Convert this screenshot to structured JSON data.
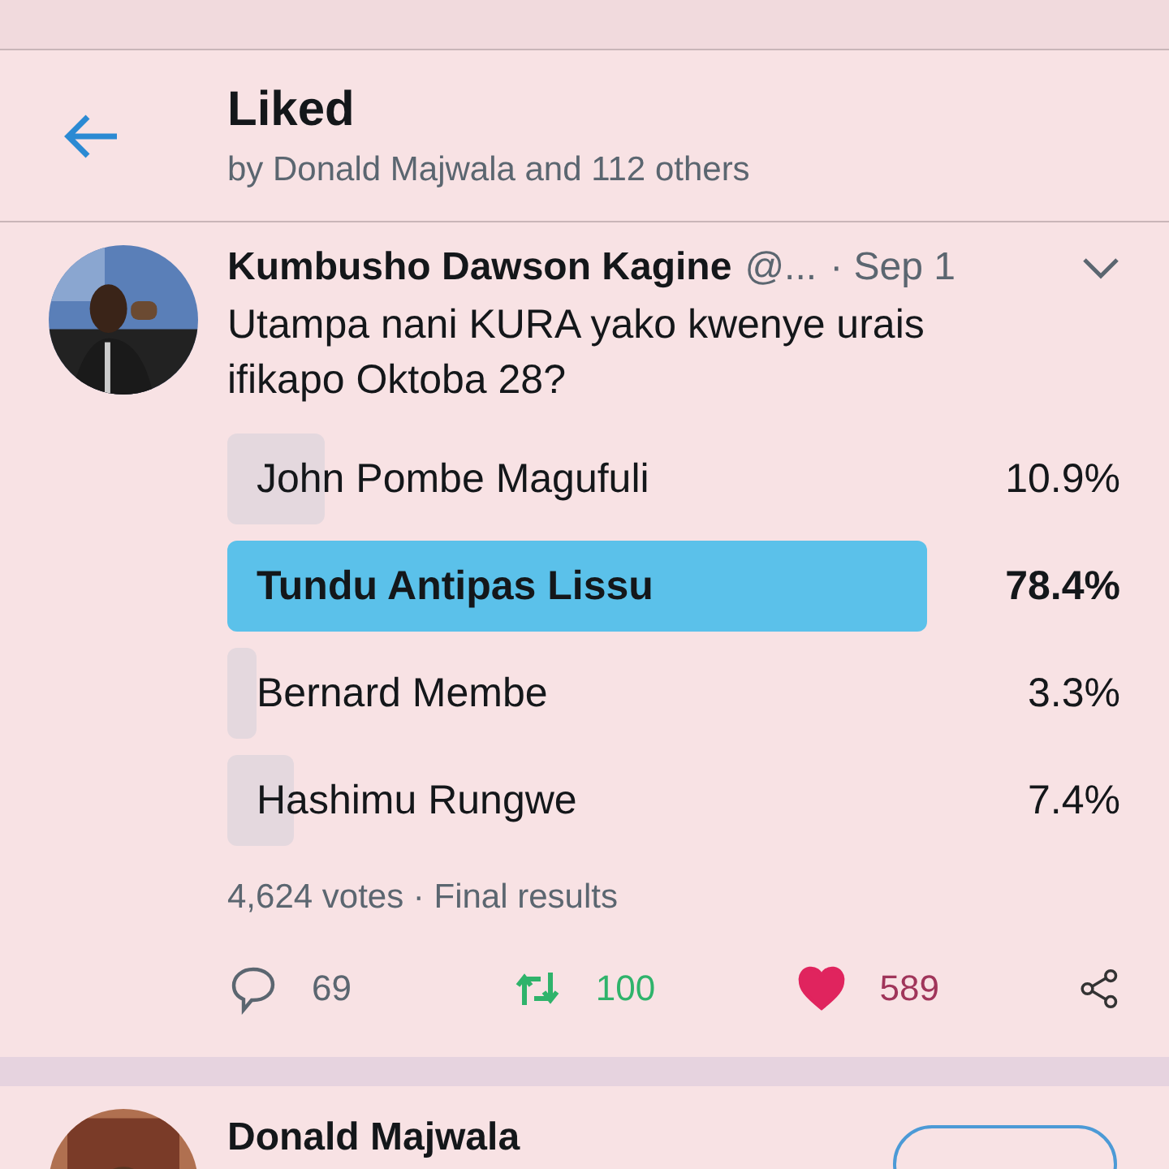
{
  "header": {
    "title": "Liked",
    "subtitle": "by Donald Majwala and 112 others"
  },
  "tweet": {
    "author": "Kumbusho Dawson Kagine",
    "handle": "@...",
    "time": "· Sep 1",
    "text": "Utampa nani KURA yako kwenye urais ifikapo Oktoba 28?",
    "poll": {
      "options": [
        {
          "label": "John Pombe Magufuli",
          "percent": "10.9%",
          "leading": false
        },
        {
          "label": "Tundu Antipas Lissu",
          "percent": "78.4%",
          "leading": true
        },
        {
          "label": "Bernard Membe",
          "percent": "3.3%",
          "leading": false
        },
        {
          "label": "Hashimu Rungwe",
          "percent": "7.4%",
          "leading": false
        }
      ],
      "summary": "4,624 votes · Final results"
    },
    "actions": {
      "replies": "69",
      "retweets": "100",
      "likes": "589",
      "liked": true
    }
  },
  "next_user": {
    "name": "Donald Majwala"
  }
}
